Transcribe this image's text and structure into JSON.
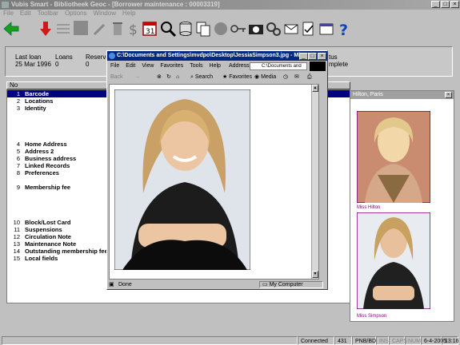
{
  "window": {
    "title": "Vubis Smart - Bibliotheek Geoc - [Borrower maintenance : 00003319]"
  },
  "menu": [
    "File",
    "Edit",
    "Toolbar",
    "Options",
    "Window",
    "Help"
  ],
  "info": {
    "last_loan_label": "Last loan",
    "last_loan_value": "25 Mar 1996",
    "loans_label": "Loans",
    "loans_value": "0",
    "reservations_label": "Reservatio",
    "reservations_value": "0",
    "status_label": "tus",
    "status_value": "mplete"
  },
  "grid": {
    "header": "No"
  },
  "rows": [
    {
      "num": "1",
      "label": "Barcode"
    },
    {
      "num": "2",
      "label": "Locations"
    },
    {
      "num": "3",
      "label": "Identity"
    },
    {
      "num": "4",
      "label": "Home Address"
    },
    {
      "num": "5",
      "label": "Address 2"
    },
    {
      "num": "6",
      "label": "Business address"
    },
    {
      "num": "7",
      "label": "Linked Records"
    },
    {
      "num": "8",
      "label": "Preferences"
    },
    {
      "num": "9",
      "label": "Membership fee"
    },
    {
      "num": "10",
      "label": "Block/Lost Card"
    },
    {
      "num": "11",
      "label": "Suspensions"
    },
    {
      "num": "12",
      "label": "Circulation Note"
    },
    {
      "num": "13",
      "label": "Maintenance Note"
    },
    {
      "num": "14",
      "label": "Outstanding membership fee"
    },
    {
      "num": "15",
      "label": "Local fields"
    }
  ],
  "rightpanel": {
    "header": "Hilton, Paris",
    "caption1": "Miss Hilton",
    "caption2": "Miss Simpson"
  },
  "ie": {
    "title": "C:\\Documents and Settings\\mvdpo\\Desktop\\JessiaSimpson3.jpg - Mic...",
    "menu": [
      "File",
      "Edit",
      "View",
      "Favorites",
      "Tools",
      "Help"
    ],
    "address_label": "Address",
    "address_value": "C:\\Documents and",
    "back_label": "Back",
    "search_label": "Search",
    "favorites_label": "Favorites",
    "media_label": "Media",
    "status_done": "Done",
    "status_zone": "My Computer"
  },
  "status": {
    "connected": "Connected",
    "count": "431",
    "db": "PNB/BD",
    "ins": "INS",
    "caps": "CAPS",
    "num": "NUM",
    "date": "6-4-2005",
    "time": "13:16"
  },
  "colors": {
    "titlebar": "#7b7b7b",
    "ie_titlebar": "#002a7f",
    "selection": "#000080",
    "caption": "#800080"
  }
}
